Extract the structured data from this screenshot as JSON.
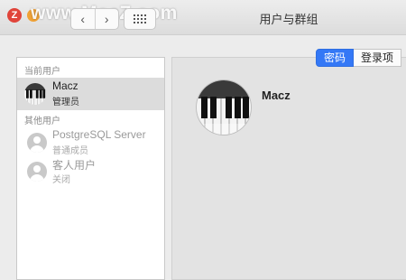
{
  "watermark": {
    "badge": "Z",
    "text": "www.MacZ.com"
  },
  "window": {
    "title": "用户与群组"
  },
  "nav": {
    "back": "‹",
    "forward": "›"
  },
  "sidebar": {
    "current_label": "当前用户",
    "current_user": {
      "name": "Macz",
      "role": "管理员"
    },
    "others_label": "其他用户",
    "other_users": [
      {
        "name": "PostgreSQL Server",
        "role": "普通成员"
      },
      {
        "name": "客人用户",
        "role": "关闭"
      }
    ]
  },
  "tabs": [
    {
      "label": "密码",
      "active": true
    },
    {
      "label": "登录项",
      "active": false
    }
  ],
  "detail": {
    "name": "Macz"
  },
  "colors": {
    "accent": "#3478f6"
  }
}
